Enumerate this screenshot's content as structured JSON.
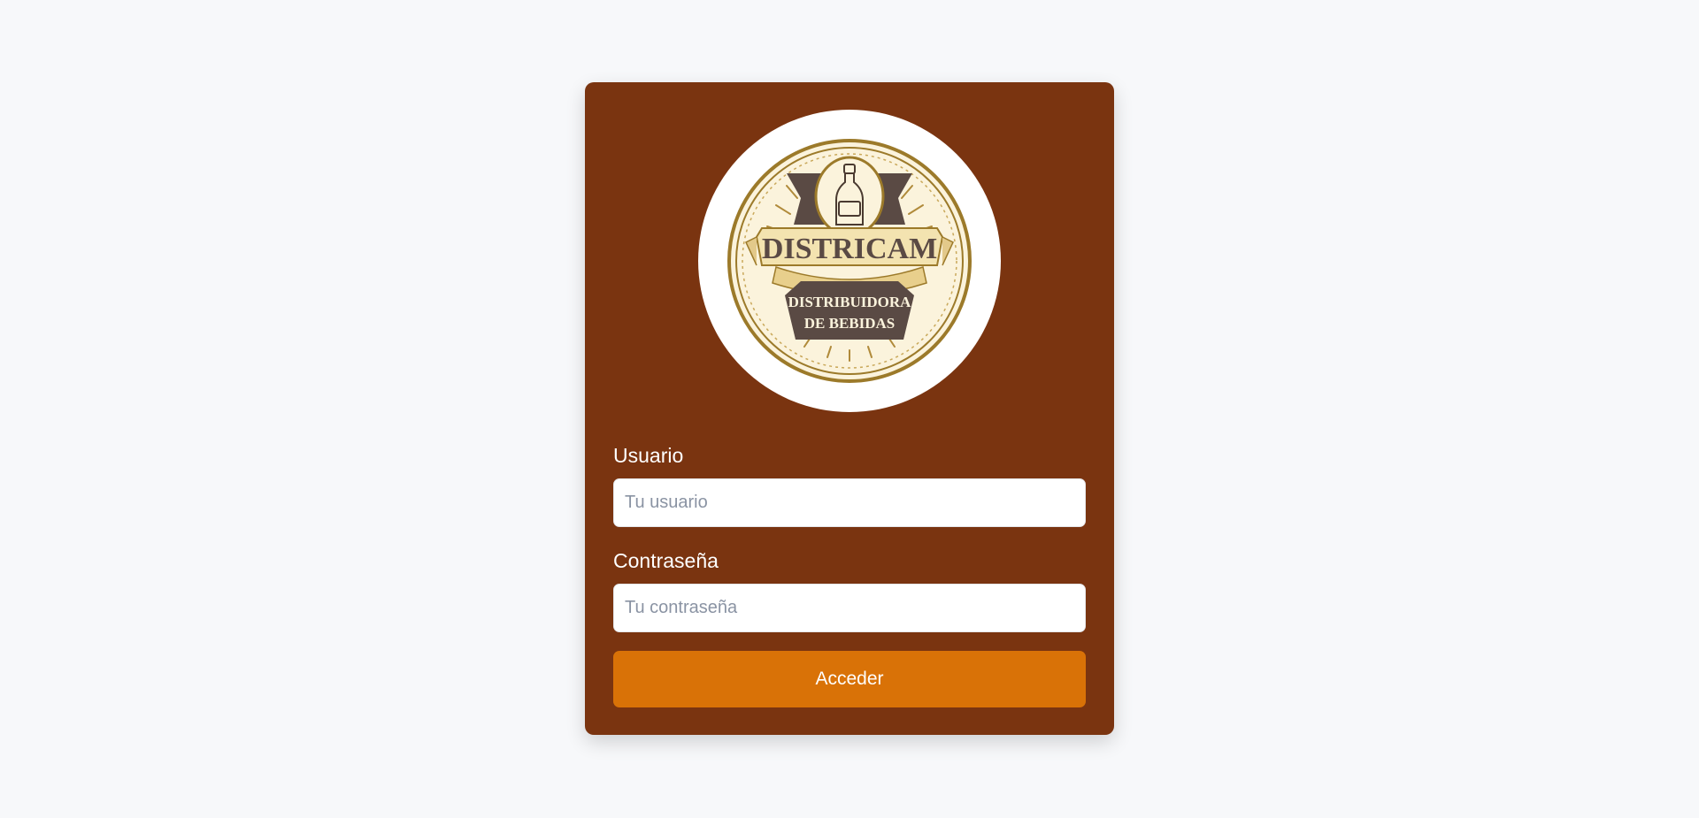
{
  "login": {
    "logo": {
      "brand": "DISTRICAM",
      "tagline_line1": "DISTRIBUIDORA",
      "tagline_line2": "DE BEBIDAS"
    },
    "username": {
      "label": "Usuario",
      "placeholder": "Tu usuario",
      "value": ""
    },
    "password": {
      "label": "Contraseña",
      "placeholder": "Tu contraseña",
      "value": ""
    },
    "submit_label": "Acceder"
  },
  "colors": {
    "page_background": "#f7f8fa",
    "card_background": "#7a3410",
    "button_background": "#d97207",
    "logo_gold": "#9c7a2a",
    "logo_cream": "#f3e3b0",
    "logo_dark": "#5a4a44"
  }
}
